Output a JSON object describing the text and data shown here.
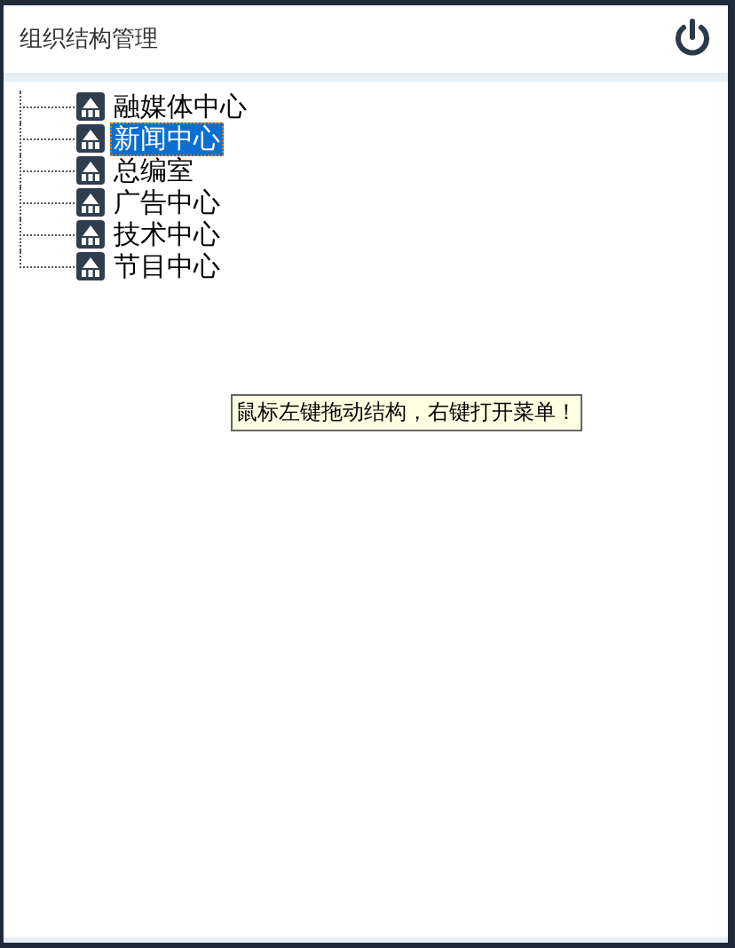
{
  "header": {
    "title": "组织结构管理"
  },
  "tree": {
    "items": [
      {
        "label": "融媒体中心",
        "selected": false
      },
      {
        "label": "新闻中心",
        "selected": true
      },
      {
        "label": "总编室",
        "selected": false
      },
      {
        "label": "广告中心",
        "selected": false
      },
      {
        "label": "技术中心",
        "selected": false
      },
      {
        "label": "节目中心",
        "selected": false
      }
    ]
  },
  "tooltip": {
    "text": "鼠标左键拖动结构，右键打开菜单！"
  }
}
